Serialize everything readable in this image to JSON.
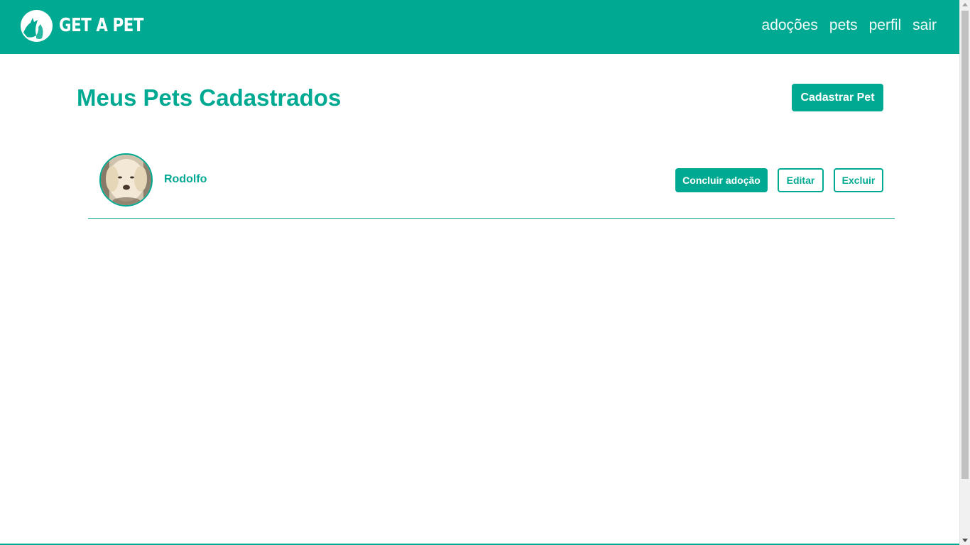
{
  "brand": {
    "name": "GET A PET",
    "logo_icon": "dog-cat-silhouette-icon"
  },
  "nav": {
    "items": [
      {
        "label": "adoções"
      },
      {
        "label": "pets"
      },
      {
        "label": "perfil"
      },
      {
        "label": "sair"
      }
    ]
  },
  "main": {
    "title": "Meus Pets Cadastrados",
    "register_button": "Cadastrar Pet",
    "pets": [
      {
        "name": "Rodolfo",
        "conclude_label": "Concluir adoção",
        "edit_label": "Editar",
        "delete_label": "Excluir"
      }
    ]
  },
  "colors": {
    "primary": "#00a991",
    "background": "#ffffff",
    "text_on_primary": "#ffffff"
  }
}
